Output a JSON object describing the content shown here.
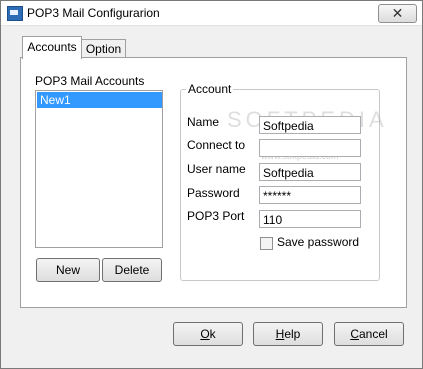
{
  "window": {
    "title": "POP3 Mail Configurarion",
    "close_glyph": "✕"
  },
  "tabs": [
    {
      "label": "Accounts",
      "active": true
    },
    {
      "label": "Option",
      "active": false
    }
  ],
  "accounts": {
    "label": "POP3 Mail Accounts",
    "items": [
      "New1"
    ],
    "new_button": "New",
    "delete_button": "Delete"
  },
  "account_group": {
    "legend": "Account",
    "fields": [
      {
        "label": "Name",
        "value": "Softpedia"
      },
      {
        "label": "Connect to",
        "value": ""
      },
      {
        "label": "User name",
        "value": "Softpedia"
      },
      {
        "label": "Password",
        "value": "******"
      },
      {
        "label": "POP3 Port",
        "value": "110"
      }
    ],
    "save_password": {
      "label": "Save password",
      "checked": false
    }
  },
  "watermark": {
    "text": "SOFTPEDIA",
    "sub": "www.softpedia.com"
  },
  "footer": {
    "ok": {
      "prefix": "",
      "mnemonic": "O",
      "rest": "k"
    },
    "help": {
      "prefix": "",
      "mnemonic": "H",
      "rest": "elp"
    },
    "cancel": {
      "prefix": "",
      "mnemonic": "C",
      "rest": "ancel"
    }
  },
  "colors": {
    "selection": "#3399ff",
    "window_bg": "#f0f0f0",
    "panel_bg": "#ffffff"
  }
}
